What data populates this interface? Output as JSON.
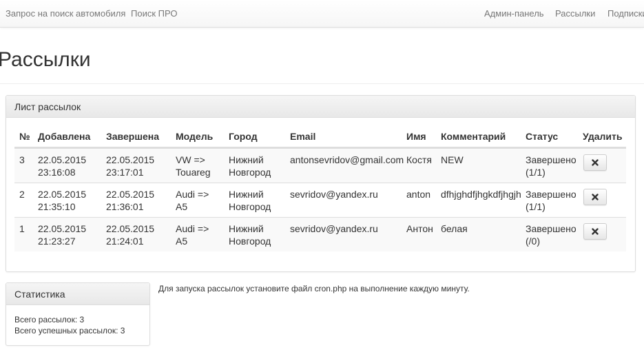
{
  "nav": {
    "left": [
      "Запрос на поиск автомобиля",
      "Поиск ПРО"
    ],
    "right": [
      "Админ-панель",
      "Рассылки",
      "Подписки"
    ]
  },
  "page": {
    "title": "Рассылки"
  },
  "mailing_panel": {
    "title": "Лист рассылок",
    "columns": [
      "№",
      "Добавлена",
      "Завершена",
      "Модель",
      "Город",
      "Email",
      "Имя",
      "Комментарий",
      "Статус",
      "Удалить"
    ],
    "rows": [
      [
        "3",
        "22.05.2015\n23:16:08",
        "22.05.2015\n23:17:01",
        "VW =>\nTouareg",
        "Нижний\nНовгород",
        "antonsevridov@gmail.com",
        "Костя",
        "NEW",
        "Завершено\n(1/1)"
      ],
      [
        "2",
        "22.05.2015\n21:35:10",
        "22.05.2015\n21:36:01",
        "Audi =>\nA5",
        "Нижний\nНовгород",
        "sevridov@yandex.ru",
        "anton",
        "dfhjghdfjhgkdfjhgjh",
        "Завершено\n(1/1)"
      ],
      [
        "1",
        "22.05.2015\n21:23:27",
        "22.05.2015\n21:24:01",
        "Audi =>\nA5",
        "Нижний\nНовгород",
        "sevridov@yandex.ru",
        "Антон",
        "белая",
        "Завершено\n(/0)"
      ]
    ],
    "delete_icon": "close-icon"
  },
  "stats_panel": {
    "title": "Статистика",
    "lines": [
      "Всего рассылок: 3",
      "Всего успешных рассылок: 3"
    ]
  },
  "cron_note": "Для запуска рассылок установите файл cron.php на выполнение каждую минуту."
}
